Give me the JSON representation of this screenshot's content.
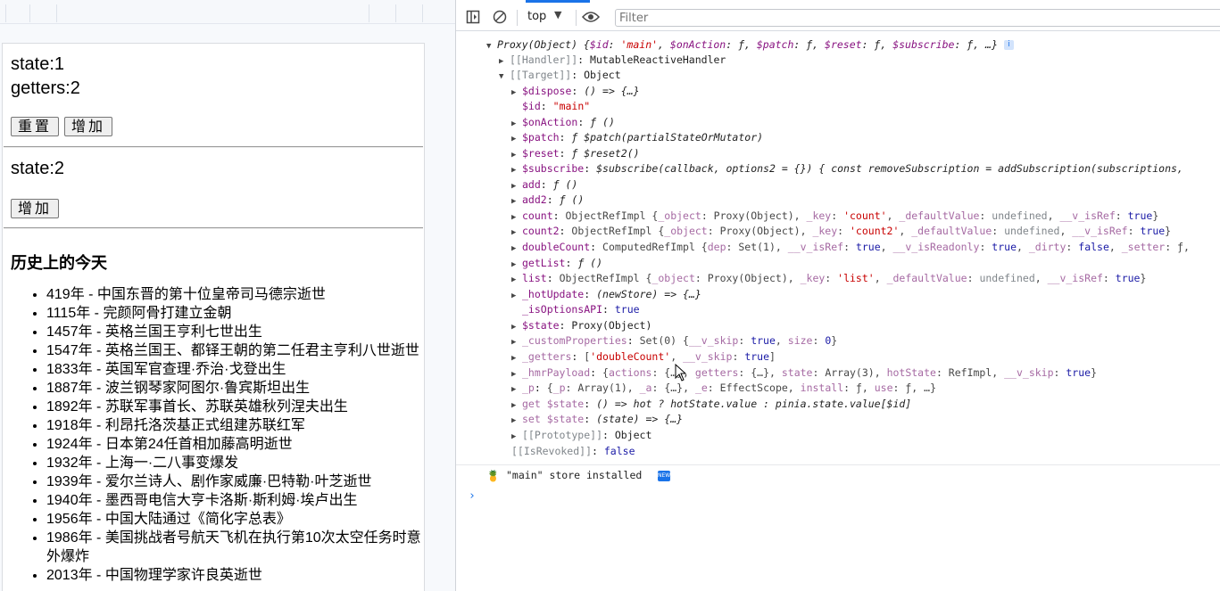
{
  "app": {
    "state1": "state:1",
    "getters": "getters:2",
    "reset_btn": "重置",
    "add_btn": "增加",
    "state2": "state:2",
    "add_btn2": "增加",
    "history_title": "历史上的今天",
    "history": [
      "419年 - 中国东晋的第十位皇帝司马德宗逝世",
      "1115年 - 完颜阿骨打建立金朝",
      "1457年 - 英格兰国王亨利七世出生",
      "1547年 - 英格兰国王、都铎王朝的第二任君主亨利八世逝世",
      "1833年 - 英国军官查理·乔治·戈登出生",
      "1887年 - 波兰钢琴家阿图尔·鲁宾斯坦出生",
      "1892年 - 苏联军事首长、苏联英雄秋列涅夫出生",
      "1918年 - 利昂托洛茨基正式组建苏联红军",
      "1924年 - 日本第24任首相加藤高明逝世",
      "1932年 - 上海一·二八事变爆发",
      "1939年 - 爱尔兰诗人、剧作家威廉·巴特勒·叶芝逝世",
      "1940年 - 墨西哥电信大亨卡洛斯·斯利姆·埃卢出生",
      "1956年 - 中国大陆通过《简化字总表》",
      "1986年 - 美国挑战者号航天飞机在执行第10次太空任务时意外爆炸",
      "2013年 - 中国物理学家许良英逝世"
    ]
  },
  "devtools": {
    "context": "top",
    "filter_placeholder": "Filter",
    "installed_msg": "\"main\" store installed",
    "new_badge": "NEW",
    "info_badge": "i",
    "prompt": "›",
    "pine_emoji": "🍍",
    "icons": [
      "sidebar-toggle-icon",
      "clear-console-icon",
      "eye-icon"
    ]
  }
}
